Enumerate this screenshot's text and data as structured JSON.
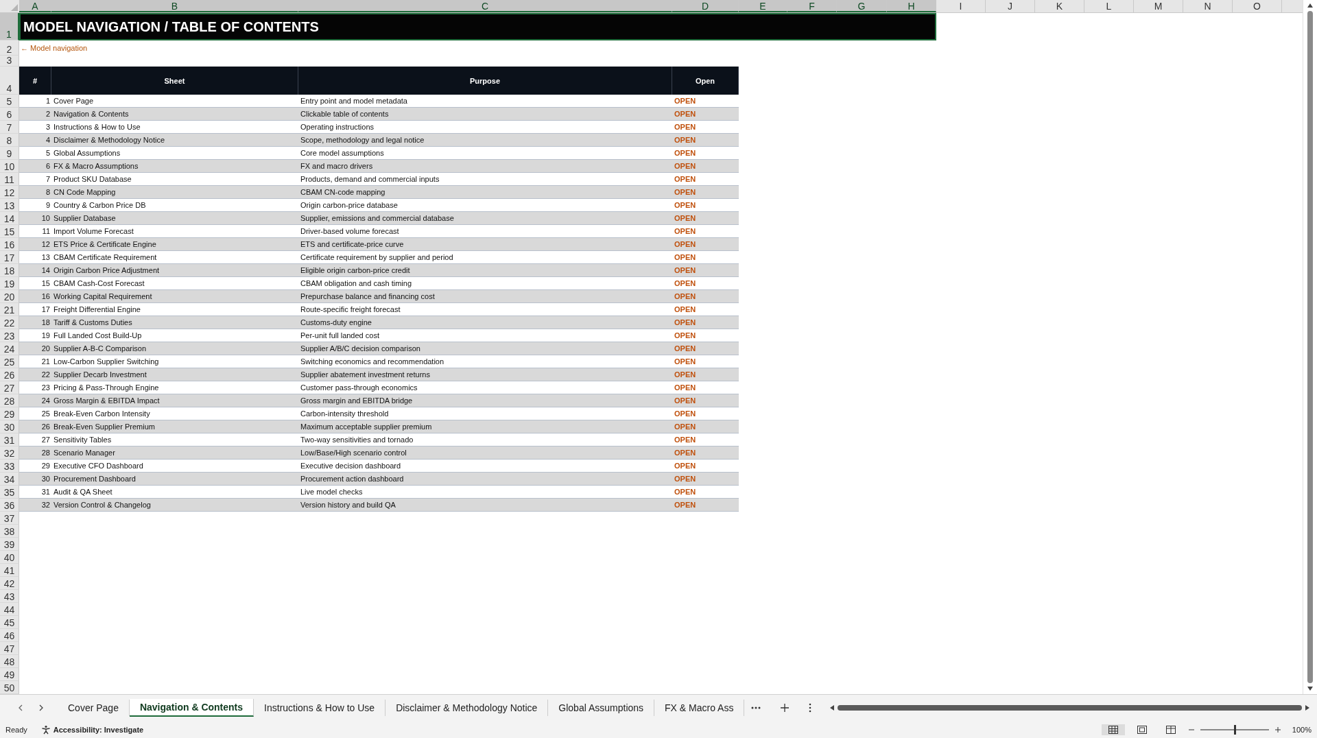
{
  "column_headers": [
    {
      "label": "A",
      "selected": true
    },
    {
      "label": "B",
      "selected": true
    },
    {
      "label": "C",
      "selected": true
    },
    {
      "label": "D",
      "selected": true
    },
    {
      "label": "E",
      "selected": true
    },
    {
      "label": "F",
      "selected": true
    },
    {
      "label": "G",
      "selected": true
    },
    {
      "label": "H",
      "selected": true
    },
    {
      "label": "I",
      "selected": false
    },
    {
      "label": "J",
      "selected": false
    },
    {
      "label": "K",
      "selected": false
    },
    {
      "label": "L",
      "selected": false
    },
    {
      "label": "M",
      "selected": false
    },
    {
      "label": "N",
      "selected": false
    },
    {
      "label": "O",
      "selected": false
    }
  ],
  "row_numbers": [
    {
      "label": "1",
      "selected": true
    },
    {
      "label": "2",
      "selected": false
    },
    {
      "label": "3",
      "selected": false
    },
    {
      "label": "4",
      "selected": false
    },
    {
      "label": "5",
      "selected": false
    },
    {
      "label": "6",
      "selected": false
    },
    {
      "label": "7",
      "selected": false
    },
    {
      "label": "8",
      "selected": false
    },
    {
      "label": "9",
      "selected": false
    },
    {
      "label": "10",
      "selected": false
    },
    {
      "label": "11",
      "selected": false
    },
    {
      "label": "12",
      "selected": false
    },
    {
      "label": "13",
      "selected": false
    },
    {
      "label": "14",
      "selected": false
    },
    {
      "label": "15",
      "selected": false
    },
    {
      "label": "16",
      "selected": false
    },
    {
      "label": "17",
      "selected": false
    },
    {
      "label": "18",
      "selected": false
    },
    {
      "label": "19",
      "selected": false
    },
    {
      "label": "20",
      "selected": false
    },
    {
      "label": "21",
      "selected": false
    },
    {
      "label": "22",
      "selected": false
    },
    {
      "label": "23",
      "selected": false
    },
    {
      "label": "24",
      "selected": false
    },
    {
      "label": "25",
      "selected": false
    },
    {
      "label": "26",
      "selected": false
    },
    {
      "label": "27",
      "selected": false
    },
    {
      "label": "28",
      "selected": false
    },
    {
      "label": "29",
      "selected": false
    },
    {
      "label": "30",
      "selected": false
    },
    {
      "label": "31",
      "selected": false
    },
    {
      "label": "32",
      "selected": false
    },
    {
      "label": "33",
      "selected": false
    },
    {
      "label": "34",
      "selected": false
    },
    {
      "label": "35",
      "selected": false
    },
    {
      "label": "36",
      "selected": false
    },
    {
      "label": "37",
      "selected": false
    },
    {
      "label": "38",
      "selected": false
    },
    {
      "label": "39",
      "selected": false
    },
    {
      "label": "40",
      "selected": false
    },
    {
      "label": "41",
      "selected": false
    },
    {
      "label": "42",
      "selected": false
    },
    {
      "label": "43",
      "selected": false
    },
    {
      "label": "44",
      "selected": false
    },
    {
      "label": "45",
      "selected": false
    },
    {
      "label": "46",
      "selected": false
    },
    {
      "label": "47",
      "selected": false
    },
    {
      "label": "48",
      "selected": false
    },
    {
      "label": "49",
      "selected": false
    },
    {
      "label": "50",
      "selected": false
    }
  ],
  "title": "MODEL NAVIGATION / TABLE OF CONTENTS",
  "back_link": "← Model navigation",
  "table": {
    "columns": [
      "#",
      "Sheet",
      "Purpose",
      "Open"
    ],
    "rows": [
      {
        "number": "1",
        "sheet": "Cover Page",
        "purpose": "Entry point and model metadata",
        "open": "OPEN"
      },
      {
        "number": "2",
        "sheet": "Navigation & Contents",
        "purpose": "Clickable table of contents",
        "open": "OPEN"
      },
      {
        "number": "3",
        "sheet": "Instructions & How to Use",
        "purpose": "Operating instructions",
        "open": "OPEN"
      },
      {
        "number": "4",
        "sheet": "Disclaimer & Methodology Notice",
        "purpose": "Scope, methodology and legal notice",
        "open": "OPEN"
      },
      {
        "number": "5",
        "sheet": "Global Assumptions",
        "purpose": "Core model assumptions",
        "open": "OPEN"
      },
      {
        "number": "6",
        "sheet": "FX & Macro Assumptions",
        "purpose": "FX and macro drivers",
        "open": "OPEN"
      },
      {
        "number": "7",
        "sheet": "Product SKU Database",
        "purpose": "Products, demand and commercial inputs",
        "open": "OPEN"
      },
      {
        "number": "8",
        "sheet": "CN Code Mapping",
        "purpose": "CBAM CN-code mapping",
        "open": "OPEN"
      },
      {
        "number": "9",
        "sheet": "Country & Carbon Price DB",
        "purpose": "Origin carbon-price database",
        "open": "OPEN"
      },
      {
        "number": "10",
        "sheet": "Supplier Database",
        "purpose": "Supplier, emissions and commercial database",
        "open": "OPEN"
      },
      {
        "number": "11",
        "sheet": "Import Volume Forecast",
        "purpose": "Driver-based volume forecast",
        "open": "OPEN"
      },
      {
        "number": "12",
        "sheet": "ETS Price & Certificate Engine",
        "purpose": "ETS and certificate-price curve",
        "open": "OPEN"
      },
      {
        "number": "13",
        "sheet": "CBAM Certificate Requirement",
        "purpose": "Certificate requirement by supplier and period",
        "open": "OPEN"
      },
      {
        "number": "14",
        "sheet": "Origin Carbon Price Adjustment",
        "purpose": "Eligible origin carbon-price credit",
        "open": "OPEN"
      },
      {
        "number": "15",
        "sheet": "CBAM Cash-Cost Forecast",
        "purpose": "CBAM obligation and cash timing",
        "open": "OPEN"
      },
      {
        "number": "16",
        "sheet": "Working Capital Requirement",
        "purpose": "Prepurchase balance and financing cost",
        "open": "OPEN"
      },
      {
        "number": "17",
        "sheet": "Freight Differential Engine",
        "purpose": "Route-specific freight forecast",
        "open": "OPEN"
      },
      {
        "number": "18",
        "sheet": "Tariff & Customs Duties",
        "purpose": "Customs-duty engine",
        "open": "OPEN"
      },
      {
        "number": "19",
        "sheet": "Full Landed Cost Build-Up",
        "purpose": "Per-unit full landed cost",
        "open": "OPEN"
      },
      {
        "number": "20",
        "sheet": "Supplier A-B-C Comparison",
        "purpose": "Supplier A/B/C decision comparison",
        "open": "OPEN"
      },
      {
        "number": "21",
        "sheet": "Low-Carbon Supplier Switching",
        "purpose": "Switching economics and recommendation",
        "open": "OPEN"
      },
      {
        "number": "22",
        "sheet": "Supplier Decarb Investment",
        "purpose": "Supplier abatement investment returns",
        "open": "OPEN"
      },
      {
        "number": "23",
        "sheet": "Pricing & Pass-Through Engine",
        "purpose": "Customer pass-through economics",
        "open": "OPEN"
      },
      {
        "number": "24",
        "sheet": "Gross Margin & EBITDA Impact",
        "purpose": "Gross margin and EBITDA bridge",
        "open": "OPEN"
      },
      {
        "number": "25",
        "sheet": "Break-Even Carbon Intensity",
        "purpose": "Carbon-intensity threshold",
        "open": "OPEN"
      },
      {
        "number": "26",
        "sheet": "Break-Even Supplier Premium",
        "purpose": "Maximum acceptable supplier premium",
        "open": "OPEN"
      },
      {
        "number": "27",
        "sheet": "Sensitivity Tables",
        "purpose": "Two-way sensitivities and tornado",
        "open": "OPEN"
      },
      {
        "number": "28",
        "sheet": "Scenario Manager",
        "purpose": "Low/Base/High scenario control",
        "open": "OPEN"
      },
      {
        "number": "29",
        "sheet": "Executive CFO Dashboard",
        "purpose": "Executive decision dashboard",
        "open": "OPEN"
      },
      {
        "number": "30",
        "sheet": "Procurement Dashboard",
        "purpose": "Procurement action dashboard",
        "open": "OPEN"
      },
      {
        "number": "31",
        "sheet": "Audit & QA Sheet",
        "purpose": "Live model checks",
        "open": "OPEN"
      },
      {
        "number": "32",
        "sheet": "Version Control & Changelog",
        "purpose": "Version history and build QA",
        "open": "OPEN"
      }
    ]
  },
  "sheet_tabs": [
    {
      "label": "Cover Page",
      "selected": false
    },
    {
      "label": "Navigation & Contents",
      "selected": true
    },
    {
      "label": "Instructions & How to Use",
      "selected": false
    },
    {
      "label": "Disclaimer & Methodology Notice",
      "selected": false
    },
    {
      "label": "Global Assumptions",
      "selected": false
    },
    {
      "label": "FX & Macro Ass",
      "selected": false
    }
  ],
  "status_bar": {
    "ready": "Ready",
    "accessibility": "Accessibility: Investigate",
    "zoom_slider": {
      "level": 0.5
    },
    "zoom": "100%"
  }
}
